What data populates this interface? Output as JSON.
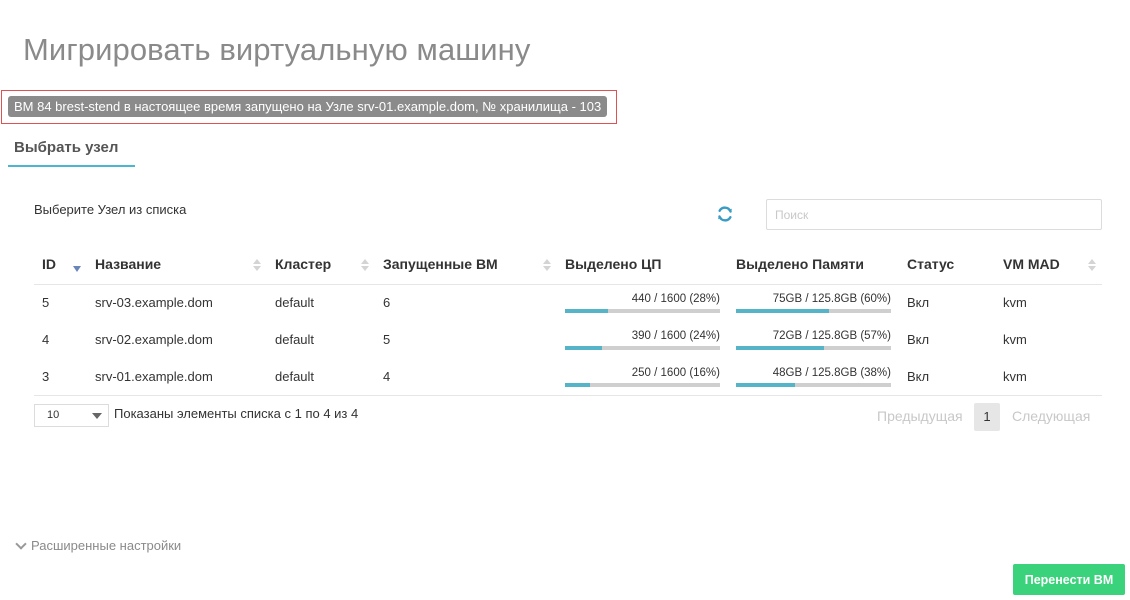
{
  "title": "Мигрировать виртуальную машину",
  "notice": "ВМ 84 brest-stend в настоящее время запущено на Узле srv-01.example.dom, № хранилища - 103",
  "tab": "Выбрать узел",
  "hint": "Выберите Узел из списка",
  "search": {
    "placeholder": "Поиск",
    "value": ""
  },
  "columns": {
    "id": "ID",
    "name": "Название",
    "cluster": "Кластер",
    "vms": "Запущенные ВМ",
    "cpu": "Выделено ЦП",
    "mem": "Выделено Памяти",
    "status": "Статус",
    "vmmad": "VM MAD"
  },
  "rows": [
    {
      "id": "5",
      "name": "srv-03.example.dom",
      "cluster": "default",
      "vms": "6",
      "cpu": "440 / 1600 (28%)",
      "cpu_pct": 28,
      "mem": "75GB / 125.8GB (60%)",
      "mem_pct": 60,
      "status": "Вкл",
      "vmmad": "kvm"
    },
    {
      "id": "4",
      "name": "srv-02.example.dom",
      "cluster": "default",
      "vms": "5",
      "cpu": "390 / 1600 (24%)",
      "cpu_pct": 24,
      "mem": "72GB / 125.8GB (57%)",
      "mem_pct": 57,
      "status": "Вкл",
      "vmmad": "kvm"
    },
    {
      "id": "3",
      "name": "srv-01.example.dom",
      "cluster": "default",
      "vms": "4",
      "cpu": "250 / 1600 (16%)",
      "cpu_pct": 16,
      "mem": "48GB / 125.8GB (38%)",
      "mem_pct": 38,
      "status": "Вкл",
      "vmmad": "kvm"
    }
  ],
  "pagination": {
    "page_size": "10",
    "info": "Показаны элементы списка с 1 по 4 из 4",
    "prev": "Предыдущая",
    "current": "1",
    "next": "Следующая"
  },
  "advanced": "Расширенные настройки",
  "submit": "Перенести ВМ",
  "colors": {
    "accent": "#4bb6cd",
    "bar_fill": "#56b4c8",
    "submit": "#3ad27b",
    "notice_bg": "#8b8b8b",
    "notice_border": "#e05252"
  },
  "icons": {
    "refresh": "refresh-icon",
    "expand": "chevron-down-icon",
    "sort": "sort-icon"
  }
}
